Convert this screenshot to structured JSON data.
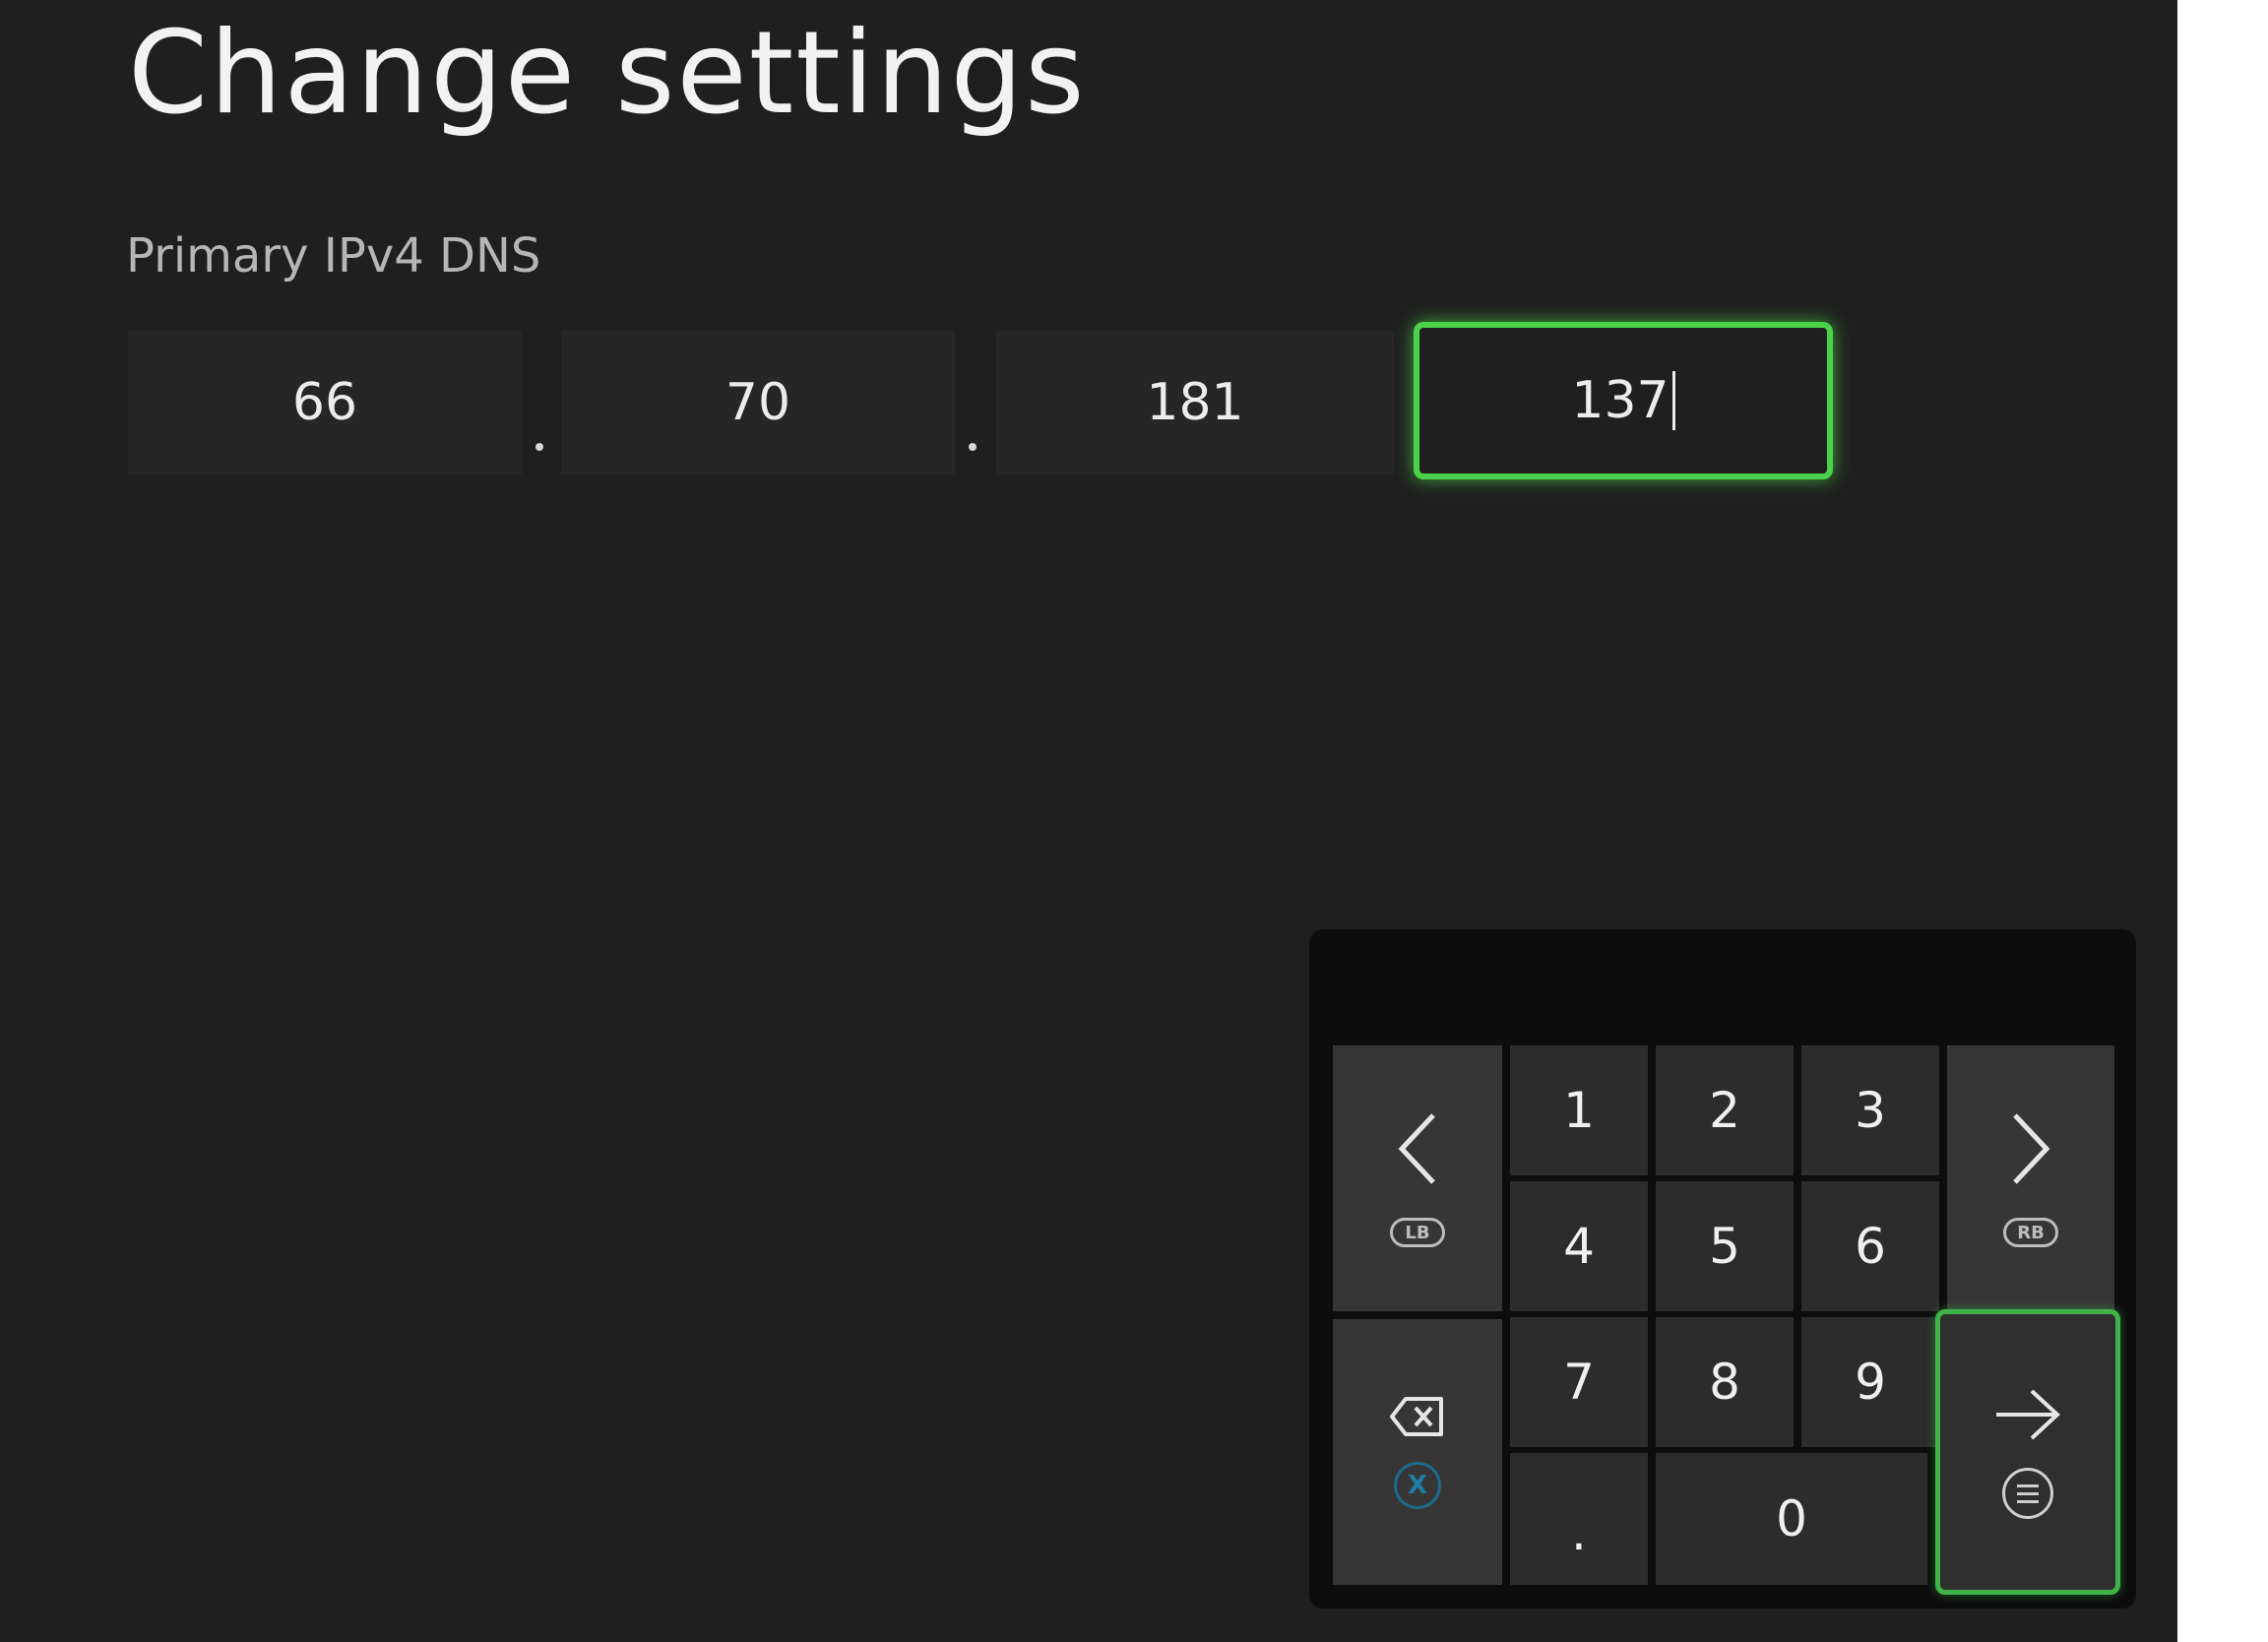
{
  "page": {
    "title": "Change settings",
    "field_label": "Primary IPv4 DNS"
  },
  "dns": {
    "octets": [
      "66",
      "70",
      "181",
      "137"
    ],
    "focused_index": 3
  },
  "keypad": {
    "digits": [
      "1",
      "2",
      "3",
      "4",
      "5",
      "6",
      "7",
      "8",
      "9",
      "0"
    ],
    "dot": ".",
    "left_badge": "LB",
    "right_badge": "RB",
    "backspace_badge": "X"
  },
  "colors": {
    "background": "#1f1f1f",
    "focus_green": "#4ad34a",
    "keypad_bg": "#0d0d0d"
  }
}
